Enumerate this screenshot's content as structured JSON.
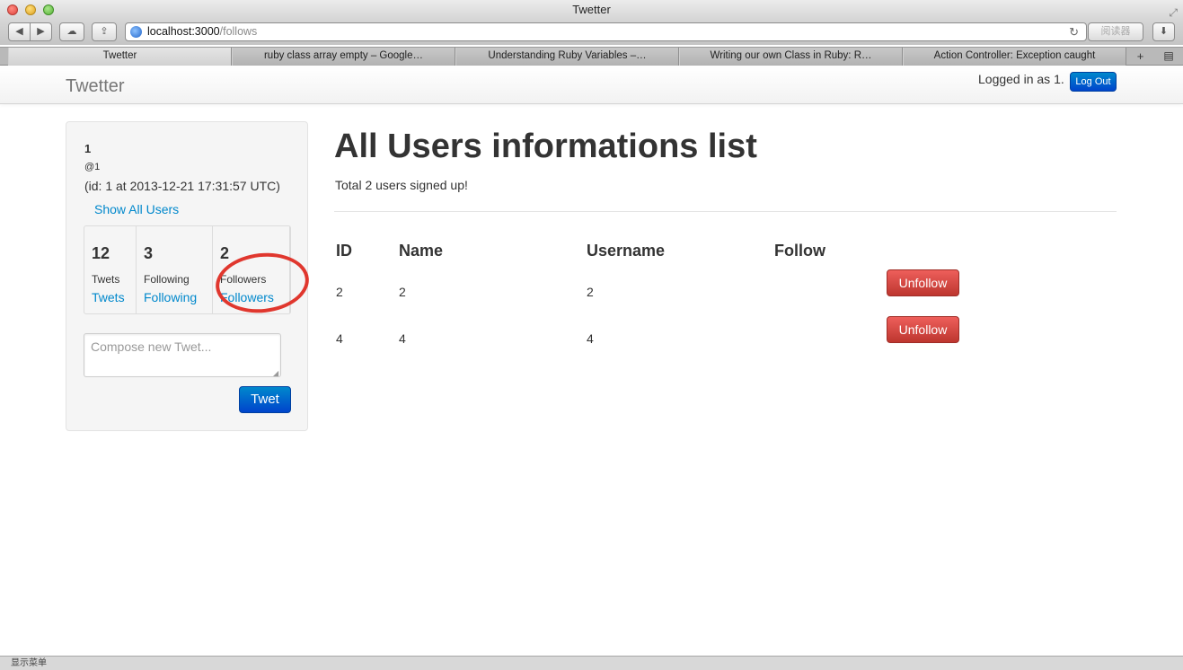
{
  "window": {
    "title": "Twetter"
  },
  "toolbar": {
    "url_host": "localhost:3000",
    "url_path": "/follows",
    "reader_label": "阅读器"
  },
  "tabs": [
    {
      "label": "Twetter",
      "active": true
    },
    {
      "label": "ruby class array empty – Google…",
      "active": false
    },
    {
      "label": "Understanding Ruby Variables –…",
      "active": false
    },
    {
      "label": "Writing our own Class in Ruby: R…",
      "active": false
    },
    {
      "label": "Action Controller: Exception caught",
      "active": false
    }
  ],
  "navbar": {
    "brand": "Twetter",
    "logged_in_text": "Logged in as 1.",
    "logout_label": "Log Out"
  },
  "sidebar": {
    "name": "1",
    "handle": "@1",
    "id_info": "(id: 1 at 2013-12-21 17:31:57 UTC)",
    "show_all_users": "Show All Users",
    "stats": [
      {
        "count": "12",
        "label": "Twets",
        "link": "Twets"
      },
      {
        "count": "3",
        "label": "Following",
        "link": "Following"
      },
      {
        "count": "2",
        "label": "Followers",
        "link": "Followers"
      }
    ],
    "compose_placeholder": "Compose new Twet...",
    "tweet_button": "Twet"
  },
  "main": {
    "title": "All Users informations list",
    "subtitle": "Total 2 users signed up!",
    "headers": [
      "ID",
      "Name",
      "Username",
      "Follow"
    ],
    "rows": [
      {
        "id": "2",
        "name": "2",
        "username": "2",
        "action": "Unfollow"
      },
      {
        "id": "4",
        "name": "4",
        "username": "4",
        "action": "Unfollow"
      }
    ]
  },
  "statusbar": {
    "text": "显示菜单"
  },
  "colors": {
    "link": "#0088cc",
    "primary_button": "#0055cc",
    "danger_button": "#bd362f",
    "annotation": "#e0372e"
  }
}
